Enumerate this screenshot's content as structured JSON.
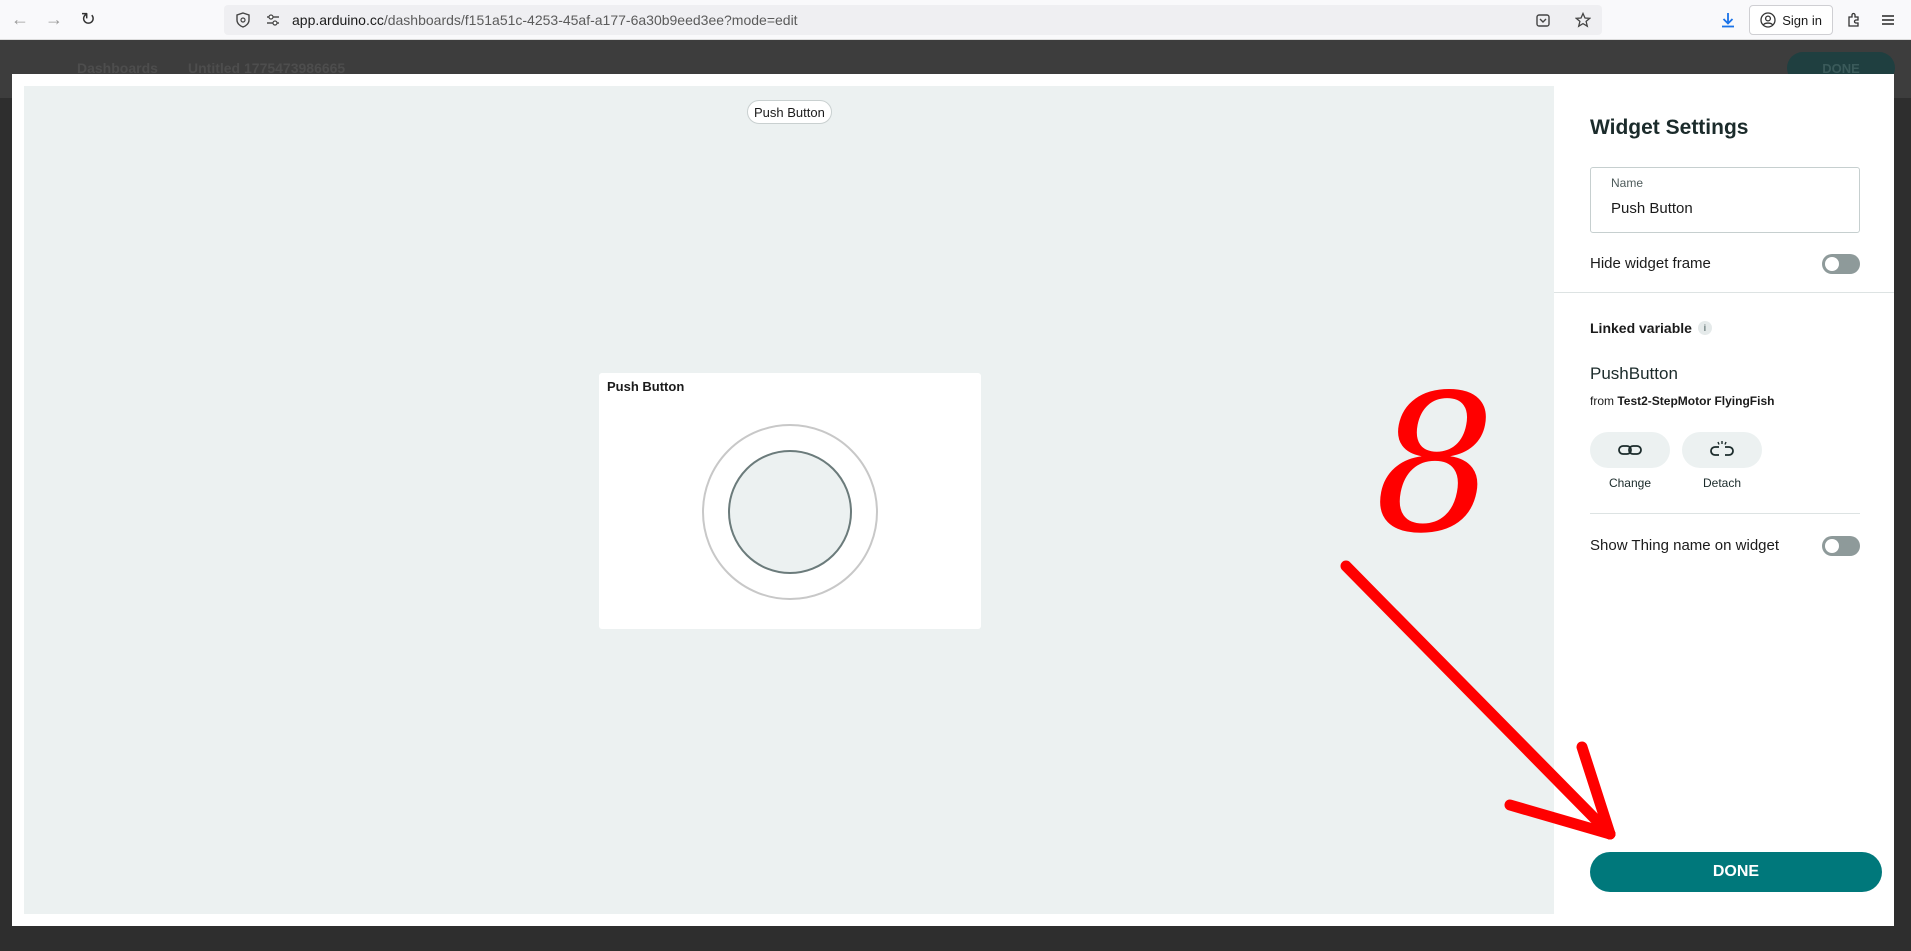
{
  "browser": {
    "url_host": "app.arduino.cc",
    "url_path": "/dashboards/f151a51c-4253-45af-a177-6a30b9eed3ee?mode=edit",
    "signin_label": "Sign in"
  },
  "background_app": {
    "breadcrumb_root": "Dashboards",
    "breadcrumb_current": "Untitled 1775473986665",
    "done_label": "DONE"
  },
  "canvas": {
    "pill_label": "Push Button",
    "widget": {
      "title": "Push Button"
    }
  },
  "settings": {
    "title": "Widget Settings",
    "name_label": "Name",
    "name_value": "Push Button",
    "hide_frame_label": "Hide widget frame",
    "hide_frame_on": false,
    "linked_variable_label": "Linked variable",
    "info_icon": "i",
    "variable_name": "PushButton",
    "from_prefix": "from",
    "thing_name": "Test2-StepMotor FlyingFish",
    "change_label": "Change",
    "detach_label": "Detach",
    "show_thing_label": "Show Thing name on widget",
    "show_thing_on": false,
    "done_label": "DONE"
  },
  "annotation": {
    "number": "8",
    "color": "#ff0000"
  },
  "colors": {
    "accent": "#00787b",
    "canvas_bg": "#ecf1f1"
  }
}
